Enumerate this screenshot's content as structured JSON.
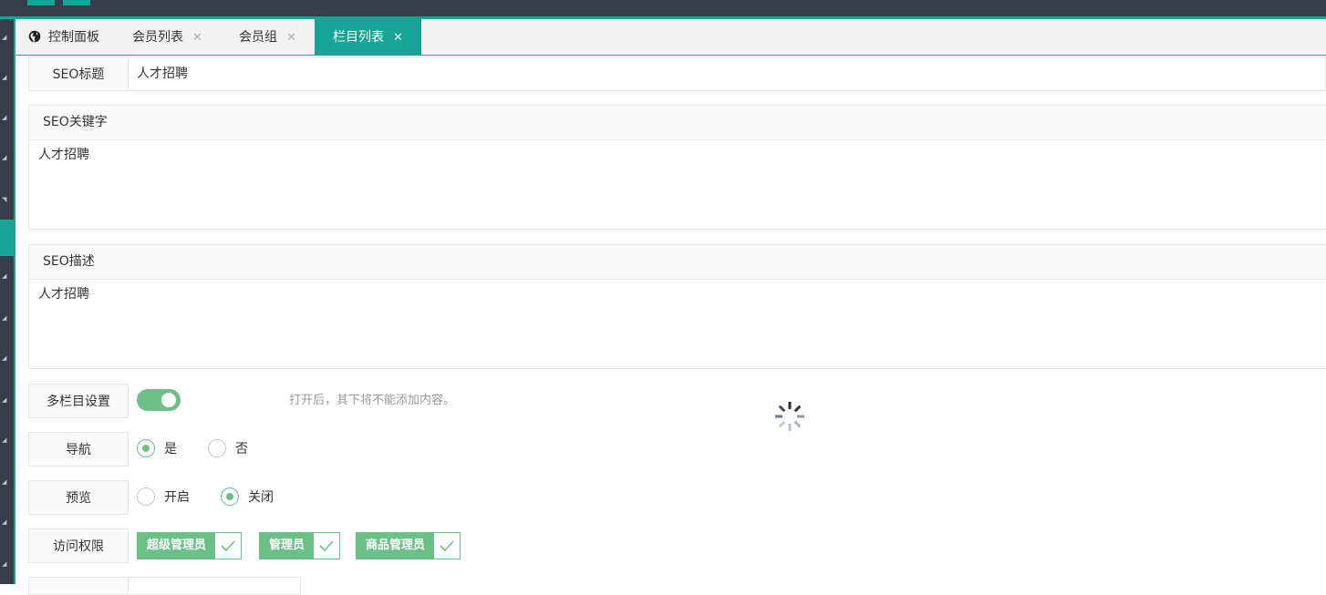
{
  "tabs": [
    {
      "label": "控制面板",
      "icon": "globe-icon",
      "closable": false
    },
    {
      "label": "会员列表",
      "closable": true
    },
    {
      "label": "会员组",
      "closable": true
    },
    {
      "label": "栏目列表",
      "closable": true,
      "active": true
    }
  ],
  "tab_close_glyph": "✕",
  "form": {
    "seo_title_label": "SEO标题",
    "seo_title_value": "人才招聘",
    "seo_keywords_label": "SEO关键字",
    "seo_keywords_value": "人才招聘",
    "seo_desc_label": "SEO描述",
    "seo_desc_value": "人才招聘",
    "multi_label": "多栏目设置",
    "multi_on": true,
    "multi_hint": "打开后，其下将不能添加内容。",
    "nav_label": "导航",
    "nav_options": [
      "是",
      "否"
    ],
    "nav_selected": "是",
    "preview_label": "预览",
    "preview_options": [
      "开启",
      "关闭"
    ],
    "preview_selected": "关闭",
    "access_label": "访问权限",
    "access_roles": [
      "超级管理员",
      "管理员",
      "商品管理员"
    ],
    "access_checked": [
      true,
      true,
      true
    ]
  },
  "colors": {
    "accent": "#16a596",
    "sidebar": "#393d49",
    "check_green": "#6cc087"
  }
}
